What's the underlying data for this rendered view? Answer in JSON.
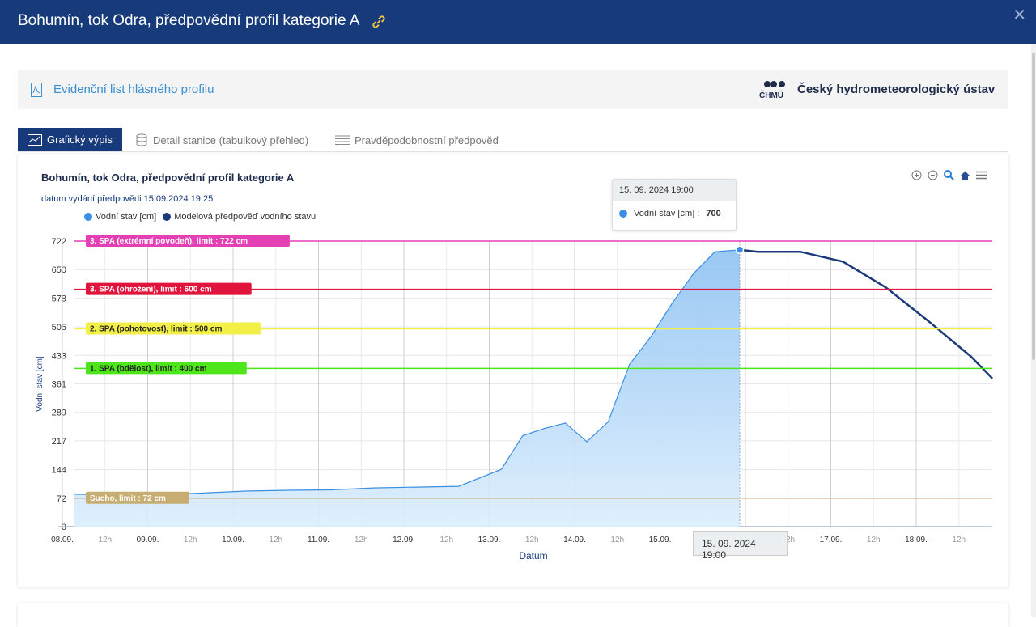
{
  "header": {
    "title": "Bohumín, tok Odra, předpovědní profil kategorie A",
    "close_label": "✕"
  },
  "infobar": {
    "document_link": "Evidenční list hlásného profilu",
    "organization": "Český hydrometeorologický ústav",
    "logo_text": "ČHMÚ"
  },
  "tabs": [
    {
      "label": "Grafický výpis",
      "active": true
    },
    {
      "label": "Detail stanice (tabulkový přehled)",
      "active": false
    },
    {
      "label": "Pravděpodobnostní předpověď",
      "active": false
    }
  ],
  "chart": {
    "title": "Bohumín, tok Odra, předpovědní profil kategorie A",
    "issued": "datum vydání předpovědi 15.09.2024 19:25",
    "tooltip": {
      "header": "15. 09. 2024 19:00",
      "label": "Vodní stav [cm] :",
      "value": "700"
    },
    "crosshair_label": "15. 09. 2024 19:00"
  },
  "chart_data": {
    "type": "area",
    "xlabel": "Datum",
    "ylabel": "Vodní stav [cm]",
    "ylim": [
      0,
      722
    ],
    "yticks": [
      0,
      72,
      144,
      217,
      289,
      361,
      433,
      505,
      578,
      650,
      722
    ],
    "xticks": [
      "08.09.",
      "12h",
      "09.09.",
      "12h",
      "10.09.",
      "12h",
      "11.09.",
      "12h",
      "12.09.",
      "12h",
      "13.09.",
      "12h",
      "14.09.",
      "12h",
      "15.09.",
      "12h",
      "16.09.",
      "12h",
      "17.09.",
      "12h",
      "18.09.",
      "12h"
    ],
    "legend_position": "top-left",
    "grid": true,
    "colors": {
      "observed": "#3a8fe3",
      "forecast": "#1a3a7a"
    },
    "series": [
      {
        "name": "Vodní stav [cm]",
        "x": [
          "2024-09-08 00:00",
          "2024-09-08 12:00",
          "2024-09-09 00:00",
          "2024-09-09 12:00",
          "2024-09-10 00:00",
          "2024-09-10 12:00",
          "2024-09-11 00:00",
          "2024-09-11 12:00",
          "2024-09-12 00:00",
          "2024-09-12 12:00",
          "2024-09-13 00:00",
          "2024-09-13 06:00",
          "2024-09-13 12:00",
          "2024-09-13 18:00",
          "2024-09-14 00:00",
          "2024-09-14 06:00",
          "2024-09-14 12:00",
          "2024-09-14 18:00",
          "2024-09-15 00:00",
          "2024-09-15 06:00",
          "2024-09-15 12:00",
          "2024-09-15 19:00"
        ],
        "y": [
          82,
          80,
          80,
          85,
          90,
          92,
          93,
          98,
          100,
          102,
          145,
          230,
          248,
          262,
          215,
          265,
          410,
          480,
          565,
          640,
          695,
          700
        ]
      },
      {
        "name": "Modelová předpověď vodního stavu",
        "x": [
          "2024-09-15 19:00",
          "2024-09-16 00:00",
          "2024-09-16 12:00",
          "2024-09-17 00:00",
          "2024-09-17 12:00",
          "2024-09-18 00:00",
          "2024-09-18 12:00",
          "2024-09-18 18:00"
        ],
        "y": [
          700,
          695,
          695,
          670,
          605,
          520,
          430,
          375
        ]
      }
    ],
    "thresholds": [
      {
        "label": "3. SPA (extrémní povodeň), limit : 722 cm",
        "value": 722,
        "color": "#e53fb4"
      },
      {
        "label": "3. SPA (ohrožení), limit : 600 cm",
        "value": 600,
        "color": "#e0143c"
      },
      {
        "label": "2. SPA (pohotovost), limit : 500 cm",
        "value": 500,
        "color": "#f2ef47"
      },
      {
        "label": "1. SPA (bdělost), limit : 400 cm",
        "value": 400,
        "color": "#4de61a"
      },
      {
        "label": "Sucho, limit : 72 cm",
        "value": 72,
        "color": "#c8ad73"
      }
    ]
  }
}
